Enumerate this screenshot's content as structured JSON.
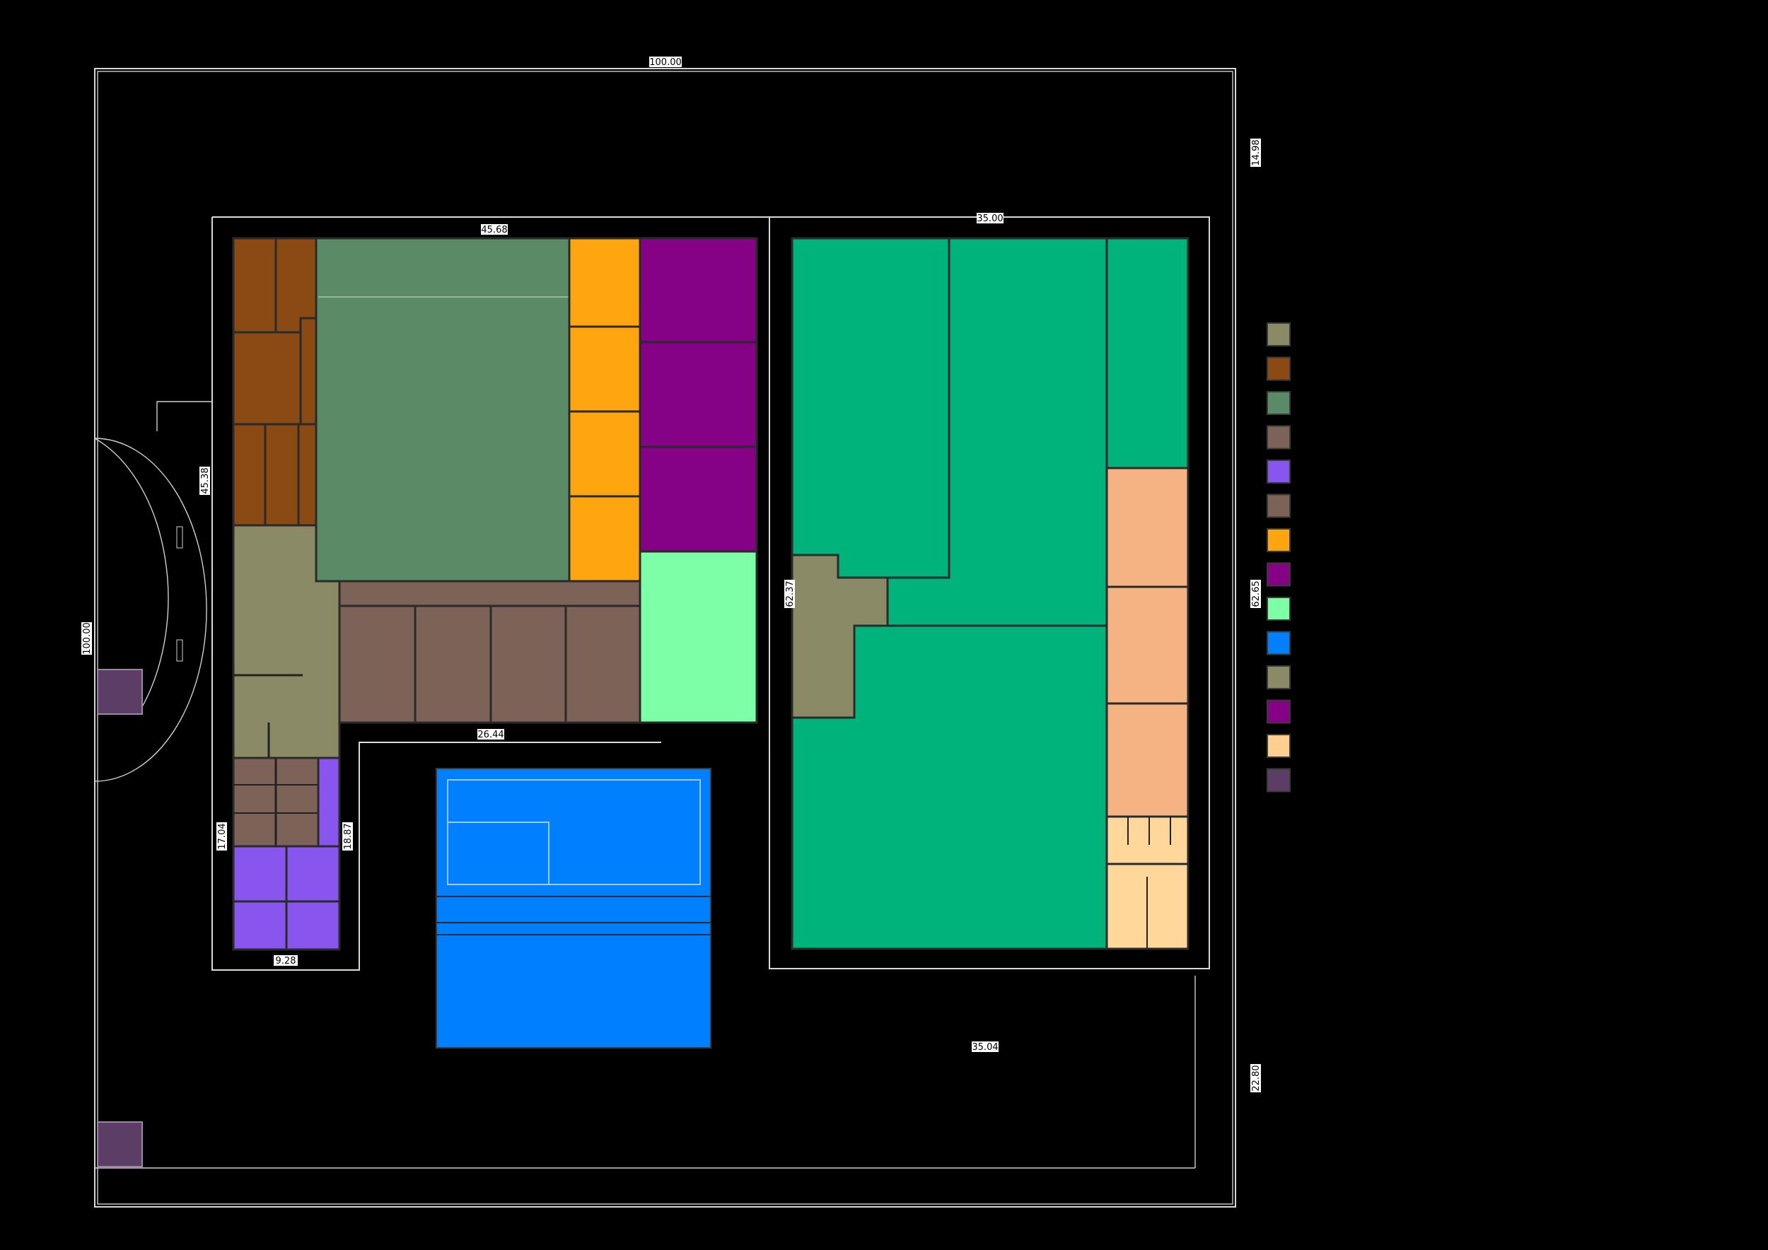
{
  "dimensions": {
    "site_width": "100.00",
    "site_height_left": "100.00",
    "top_setback_right": "14.98",
    "bottom_setback_right": "22.80",
    "west_block_width": "45.68",
    "east_block_width": "35.00",
    "east_block_height": "62.65",
    "west_curve_dim": "45.38",
    "corridor_width": "26.44",
    "south_wing_height_left": "17.04",
    "south_wing_height_right": "18.87",
    "south_wing_width": "9.28",
    "bottom_gap_width": "35.04",
    "lobby_dim": "62.37"
  },
  "legend": {
    "swatch_colors": [
      "#8a8b66",
      "#8b4a14",
      "#5a8a66",
      "#7d6258",
      "#8855ee",
      "#7d6258",
      "#ffa510",
      "#850185",
      "#7dffa8",
      "#0080ff",
      "#8a8b66",
      "#850185",
      "#ffcf90",
      "#5c3d66"
    ]
  },
  "colors": {
    "background": "#000000",
    "lobby_olive": "#8a8b66",
    "admin_brown": "#8b4a14",
    "hall_green": "#5a8a66",
    "classroom_taupe": "#7d6258",
    "purple_rooms": "#8855ee",
    "orange_rooms": "#ffa510",
    "magenta_rooms": "#850185",
    "mint_room": "#7dffa8",
    "pool_blue": "#0080ff",
    "gym_green": "#00b37a",
    "peach_rooms": "#f5b383",
    "locker_yellow": "#ffd79a",
    "guard_purple": "#5c3d66"
  }
}
